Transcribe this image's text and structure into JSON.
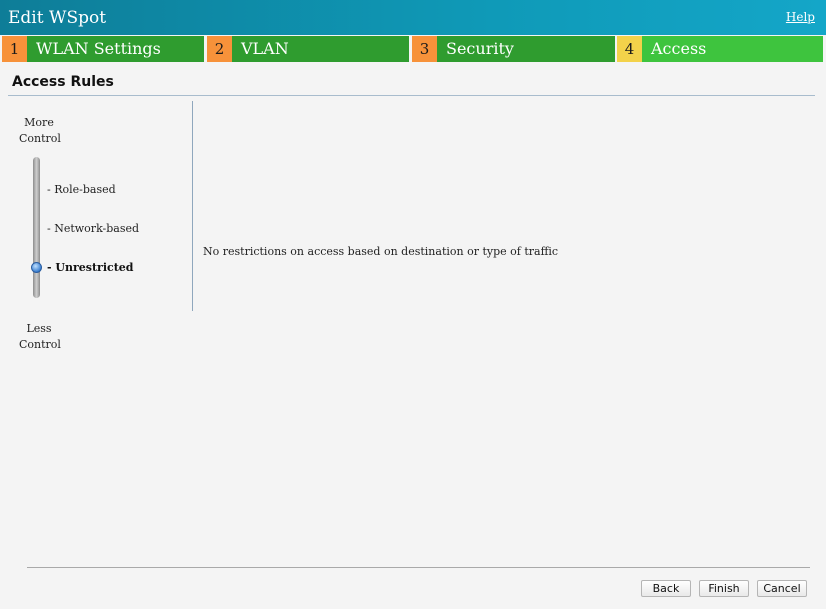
{
  "window": {
    "title": "Edit WSpot",
    "help_label": "Help"
  },
  "steps": [
    {
      "num": "1",
      "label": "WLAN Settings"
    },
    {
      "num": "2",
      "label": "VLAN"
    },
    {
      "num": "3",
      "label": "Security"
    },
    {
      "num": "4",
      "label": "Access"
    }
  ],
  "access_rules": {
    "title": "Access Rules",
    "more_control": [
      "More",
      "Control"
    ],
    "less_control": [
      "Less",
      "Control"
    ],
    "options": [
      "- Role-based",
      "- Network-based",
      "- Unrestricted"
    ],
    "selected_option": "- Unrestricted",
    "description": "No restrictions on access based on destination or type of traffic"
  },
  "buttons": {
    "back": "Back",
    "finish": "Finish",
    "cancel": "Cancel"
  },
  "colors": {
    "titlebar": "#0f9ab8",
    "step_number": "#f7923a",
    "step_number_active": "#f3d24a",
    "step_label": "#2f9c2f",
    "step_label_active": "#3ec43e"
  }
}
